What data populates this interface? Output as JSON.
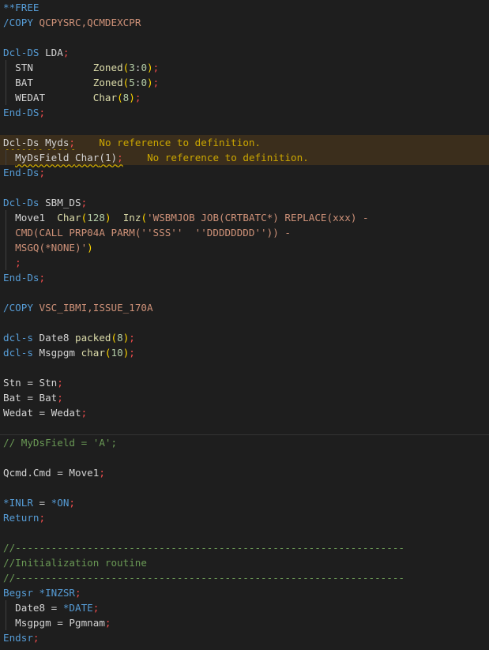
{
  "editor": {
    "colors": {
      "background": "#1e1e1e",
      "keyword": "#569cd6",
      "string": "#ce9178",
      "number": "#b5cea8",
      "comment": "#6a9955",
      "warning_background": "#3b2e1c",
      "warning_text": "#cca700",
      "semicolon": "#f14c4c",
      "bracket": "#ffd700"
    },
    "lines": [
      {
        "text": "**FREE",
        "tokens": [
          {
            "t": "**FREE",
            "c": "kw"
          }
        ]
      },
      {
        "text": "/COPY QCPYSRC,QCMDEXCPR",
        "tokens": [
          {
            "t": "/COPY ",
            "c": "kw"
          },
          {
            "t": "QCPYSRC,QCMDEXCPR",
            "c": "str"
          }
        ]
      },
      {
        "text": "",
        "tokens": []
      },
      {
        "text": "Dcl-DS LDA;",
        "tokens": [
          {
            "t": "Dcl-DS ",
            "c": "kw"
          },
          {
            "t": "LDA",
            "c": "var"
          },
          {
            "t": ";",
            "c": "semi"
          }
        ]
      },
      {
        "text": "  STN          Zoned(3:0);",
        "guide": true,
        "tokens": [
          {
            "t": "  STN          ",
            "c": "var"
          },
          {
            "t": "Zoned",
            "c": "fn"
          },
          {
            "t": "(",
            "c": "par"
          },
          {
            "t": "3",
            "c": "num"
          },
          {
            "t": ":",
            "c": "op"
          },
          {
            "t": "0",
            "c": "num"
          },
          {
            "t": ")",
            "c": "par"
          },
          {
            "t": ";",
            "c": "semi"
          }
        ]
      },
      {
        "text": "  BAT          Zoned(5:0);",
        "guide": true,
        "tokens": [
          {
            "t": "  BAT          ",
            "c": "var"
          },
          {
            "t": "Zoned",
            "c": "fn"
          },
          {
            "t": "(",
            "c": "par"
          },
          {
            "t": "5",
            "c": "num"
          },
          {
            "t": ":",
            "c": "op"
          },
          {
            "t": "0",
            "c": "num"
          },
          {
            "t": ")",
            "c": "par"
          },
          {
            "t": ";",
            "c": "semi"
          }
        ]
      },
      {
        "text": "  WEDAT        Char(8);",
        "guide": true,
        "tokens": [
          {
            "t": "  WEDAT        ",
            "c": "var"
          },
          {
            "t": "Char",
            "c": "fn"
          },
          {
            "t": "(",
            "c": "par"
          },
          {
            "t": "8",
            "c": "num"
          },
          {
            "t": ")",
            "c": "par"
          },
          {
            "t": ";",
            "c": "semi"
          }
        ]
      },
      {
        "text": "End-DS;",
        "tokens": [
          {
            "t": "End-DS",
            "c": "kw"
          },
          {
            "t": ";",
            "c": "semi"
          }
        ]
      },
      {
        "text": "",
        "tokens": []
      },
      {
        "text": "Dcl-Ds Myds;",
        "warn": true,
        "diagnostic": "No reference to definition.",
        "tokens": [
          {
            "t": "Dcl-Ds ",
            "c": "kw sq"
          },
          {
            "t": "Myds",
            "c": "sq"
          },
          {
            "t": ";",
            "c": "semi sq"
          },
          {
            "t": "    ",
            "c": "op"
          },
          {
            "t": "No reference to definition.",
            "c": "diag"
          }
        ]
      },
      {
        "text": "  MyDsField Char(1);",
        "warn": true,
        "guide": true,
        "diagnostic": "No reference to definition.",
        "tokens": [
          {
            "t": "  ",
            "c": "op"
          },
          {
            "t": "MyDsField ",
            "c": "sq"
          },
          {
            "t": "Char",
            "c": "fn sq"
          },
          {
            "t": "(",
            "c": "par sq"
          },
          {
            "t": "1",
            "c": "num sq"
          },
          {
            "t": ")",
            "c": "par sq"
          },
          {
            "t": ";",
            "c": "semi sq"
          },
          {
            "t": "    ",
            "c": "op"
          },
          {
            "t": "No reference to definition.",
            "c": "diag"
          }
        ]
      },
      {
        "text": "End-Ds;",
        "tokens": [
          {
            "t": "End-Ds",
            "c": "kw"
          },
          {
            "t": ";",
            "c": "semi"
          }
        ]
      },
      {
        "text": "",
        "tokens": []
      },
      {
        "text": "Dcl-Ds SBM_DS;",
        "tokens": [
          {
            "t": "Dcl-Ds ",
            "c": "kw"
          },
          {
            "t": "SBM_DS",
            "c": "var"
          },
          {
            "t": ";",
            "c": "semi"
          }
        ]
      },
      {
        "text": "  Move1  Char(128)  Inz('WSBMJOB JOB(CRTBATC*) REPLACE(xxx) -",
        "guide": true,
        "tokens": [
          {
            "t": "  Move1  ",
            "c": "var"
          },
          {
            "t": "Char",
            "c": "fn"
          },
          {
            "t": "(",
            "c": "par"
          },
          {
            "t": "128",
            "c": "num"
          },
          {
            "t": ")",
            "c": "par"
          },
          {
            "t": "  ",
            "c": "op"
          },
          {
            "t": "Inz",
            "c": "fn"
          },
          {
            "t": "(",
            "c": "par"
          },
          {
            "t": "'WSBMJOB JOB(CRTBATC*) REPLACE(xxx) -",
            "c": "str"
          }
        ]
      },
      {
        "text": "  CMD(CALL PRP04A PARM(''SSS''  ''DDDDDDDD'')) -",
        "guide": true,
        "tokens": [
          {
            "t": "  ",
            "c": "op"
          },
          {
            "t": "CMD(CALL PRP04A PARM(''SSS''  ''DDDDDDDD'')) -",
            "c": "str"
          }
        ]
      },
      {
        "text": "  MSGQ(*NONE)')",
        "guide": true,
        "tokens": [
          {
            "t": "  ",
            "c": "op"
          },
          {
            "t": "MSGQ(*NONE)'",
            "c": "str"
          },
          {
            "t": ")",
            "c": "par"
          }
        ]
      },
      {
        "text": "  ;",
        "guide": true,
        "tokens": [
          {
            "t": "  ",
            "c": "op"
          },
          {
            "t": ";",
            "c": "semi"
          }
        ]
      },
      {
        "text": "End-Ds;",
        "tokens": [
          {
            "t": "End-Ds",
            "c": "kw"
          },
          {
            "t": ";",
            "c": "semi"
          }
        ]
      },
      {
        "text": "",
        "tokens": []
      },
      {
        "text": "/COPY VSC_IBMI,ISSUE_170A",
        "tokens": [
          {
            "t": "/COPY ",
            "c": "kw"
          },
          {
            "t": "VSC_IBMI,ISSUE_170A",
            "c": "str"
          }
        ]
      },
      {
        "text": "",
        "tokens": []
      },
      {
        "text": "dcl-s Date8 packed(8);",
        "tokens": [
          {
            "t": "dcl-s ",
            "c": "kw"
          },
          {
            "t": "Date8 ",
            "c": "var"
          },
          {
            "t": "packed",
            "c": "fn"
          },
          {
            "t": "(",
            "c": "par"
          },
          {
            "t": "8",
            "c": "num"
          },
          {
            "t": ")",
            "c": "par"
          },
          {
            "t": ";",
            "c": "semi"
          }
        ]
      },
      {
        "text": "dcl-s Msgpgm char(10);",
        "tokens": [
          {
            "t": "dcl-s ",
            "c": "kw"
          },
          {
            "t": "Msgpgm ",
            "c": "var"
          },
          {
            "t": "char",
            "c": "fn"
          },
          {
            "t": "(",
            "c": "par"
          },
          {
            "t": "10",
            "c": "num"
          },
          {
            "t": ")",
            "c": "par"
          },
          {
            "t": ";",
            "c": "semi"
          }
        ]
      },
      {
        "text": "",
        "tokens": []
      },
      {
        "text": "Stn = Stn;",
        "tokens": [
          {
            "t": "Stn = Stn",
            "c": "var"
          },
          {
            "t": ";",
            "c": "semi"
          }
        ]
      },
      {
        "text": "Bat = Bat;",
        "tokens": [
          {
            "t": "Bat = Bat",
            "c": "var"
          },
          {
            "t": ";",
            "c": "semi"
          }
        ]
      },
      {
        "text": "Wedat = Wedat;",
        "tokens": [
          {
            "t": "Wedat = Wedat",
            "c": "var"
          },
          {
            "t": ";",
            "c": "semi"
          }
        ]
      },
      {
        "text": "",
        "sep": true,
        "tokens": []
      },
      {
        "text": "// MyDsField = 'A';",
        "tokens": [
          {
            "t": "// MyDsField = 'A';",
            "c": "cmt"
          }
        ]
      },
      {
        "text": "",
        "tokens": []
      },
      {
        "text": "Qcmd.Cmd = Move1;",
        "tokens": [
          {
            "t": "Qcmd.Cmd = Move1",
            "c": "var"
          },
          {
            "t": ";",
            "c": "semi"
          }
        ]
      },
      {
        "text": "",
        "tokens": []
      },
      {
        "text": "*INLR = *ON;",
        "tokens": [
          {
            "t": "*INLR",
            "c": "kw"
          },
          {
            "t": " = ",
            "c": "op"
          },
          {
            "t": "*ON",
            "c": "kw"
          },
          {
            "t": ";",
            "c": "semi"
          }
        ]
      },
      {
        "text": "Return;",
        "tokens": [
          {
            "t": "Return",
            "c": "kw"
          },
          {
            "t": ";",
            "c": "semi"
          }
        ]
      },
      {
        "text": "",
        "tokens": []
      },
      {
        "text": "//-----------------------------------------------------------------",
        "tokens": [
          {
            "t": "//-----------------------------------------------------------------",
            "c": "cmt"
          }
        ]
      },
      {
        "text": "//Initialization routine",
        "tokens": [
          {
            "t": "//Initialization routine",
            "c": "cmt"
          }
        ]
      },
      {
        "text": "//-----------------------------------------------------------------",
        "tokens": [
          {
            "t": "//-----------------------------------------------------------------",
            "c": "cmt"
          }
        ]
      },
      {
        "text": "Begsr *INZSR;",
        "tokens": [
          {
            "t": "Begsr ",
            "c": "kw"
          },
          {
            "t": "*INZSR",
            "c": "kw"
          },
          {
            "t": ";",
            "c": "semi"
          }
        ]
      },
      {
        "text": "  Date8 = *DATE;",
        "guide": true,
        "tokens": [
          {
            "t": "  Date8 = ",
            "c": "var"
          },
          {
            "t": "*DATE",
            "c": "kw"
          },
          {
            "t": ";",
            "c": "semi"
          }
        ]
      },
      {
        "text": "  Msgpgm = Pgmnam;",
        "guide": true,
        "tokens": [
          {
            "t": "  Msgpgm = Pgmnam",
            "c": "var"
          },
          {
            "t": ";",
            "c": "semi"
          }
        ]
      },
      {
        "text": "Endsr;",
        "tokens": [
          {
            "t": "Endsr",
            "c": "kw"
          },
          {
            "t": ";",
            "c": "semi"
          }
        ]
      }
    ]
  }
}
